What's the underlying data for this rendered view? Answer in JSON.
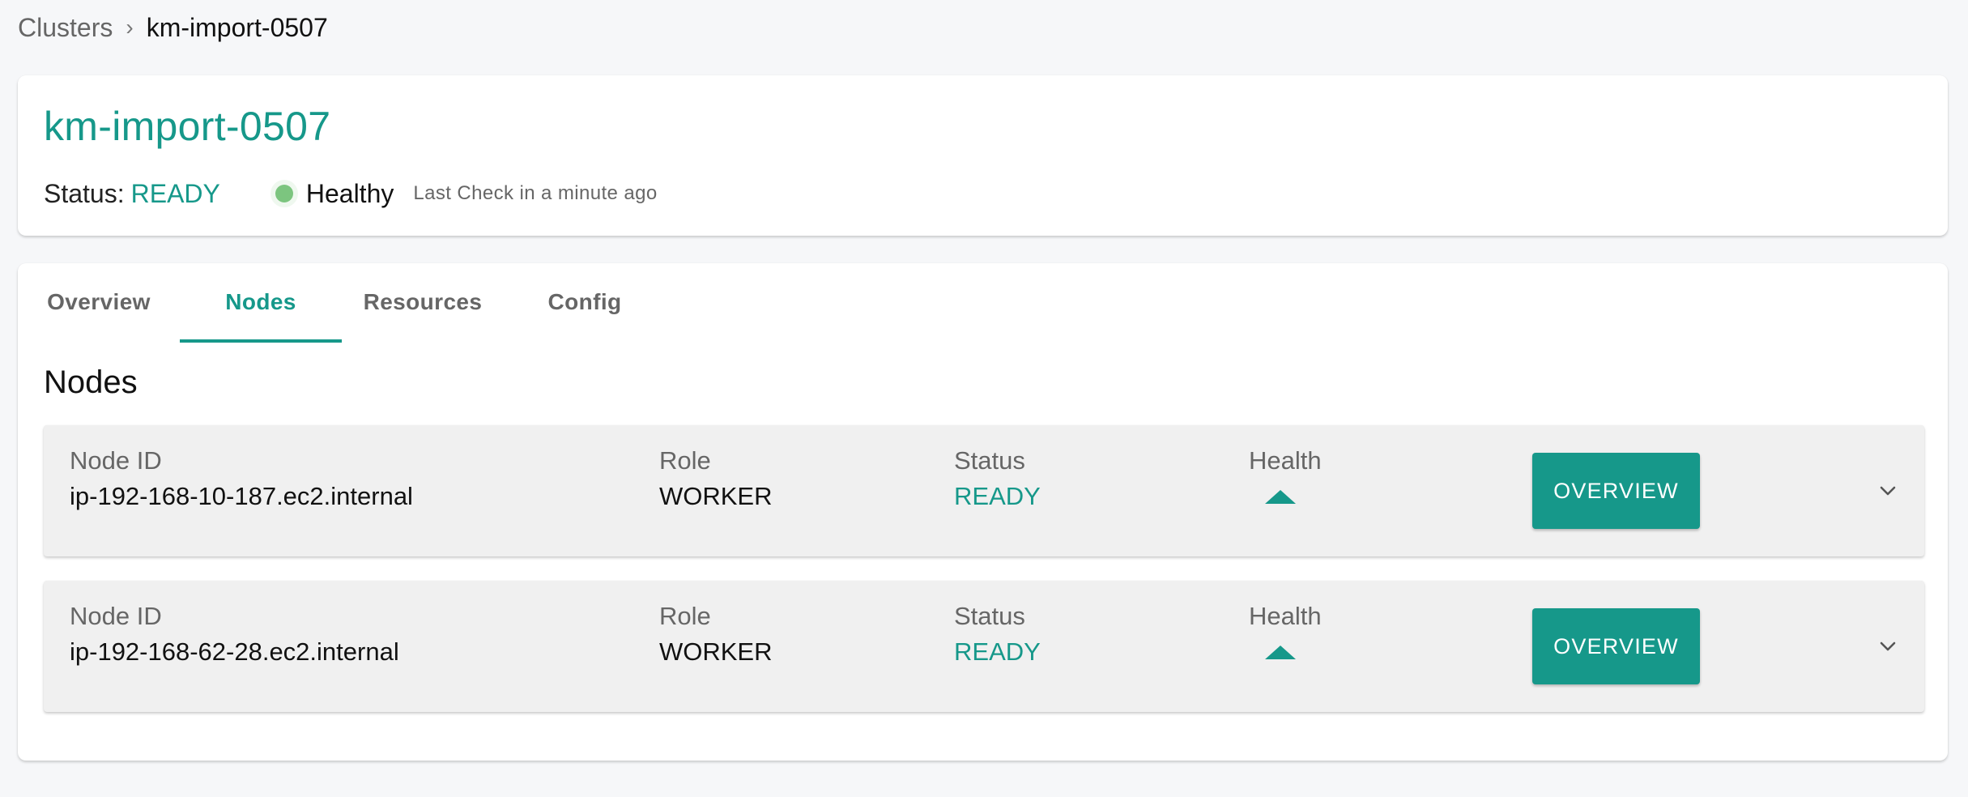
{
  "breadcrumb": {
    "parent": "Clusters",
    "separator": "›",
    "current": "km-import-0507"
  },
  "header": {
    "title": "km-import-0507",
    "status_label": "Status:",
    "status_value": "READY",
    "health_text": "Healthy",
    "last_check": "Last Check in a minute ago"
  },
  "tabs": [
    {
      "label": "Overview",
      "active": false
    },
    {
      "label": "Nodes",
      "active": true
    },
    {
      "label": "Resources",
      "active": false
    },
    {
      "label": "Config",
      "active": false
    }
  ],
  "section_title": "Nodes",
  "columns": {
    "node_id": "Node ID",
    "role": "Role",
    "status": "Status",
    "health": "Health"
  },
  "nodes": [
    {
      "node_id": "ip-192-168-10-187.ec2.internal",
      "role": "WORKER",
      "status": "READY",
      "health_icon": "triangle-up-icon",
      "button_label": "OVERVIEW"
    },
    {
      "node_id": "ip-192-168-62-28.ec2.internal",
      "role": "WORKER",
      "status": "READY",
      "health_icon": "triangle-up-icon",
      "button_label": "OVERVIEW"
    }
  ],
  "colors": {
    "accent": "#16988a",
    "healthy_dot": "#7cc57f",
    "background": "#f6f7f9"
  }
}
